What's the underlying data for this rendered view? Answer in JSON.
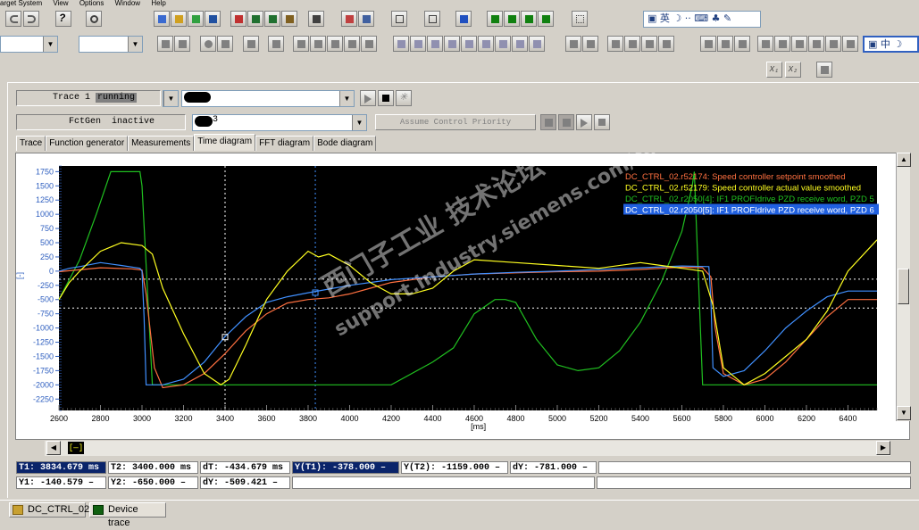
{
  "menubar": [
    "arget System",
    "View",
    "Options",
    "Window",
    "Help"
  ],
  "ime_top": {
    "label": "英",
    "extra": "☽ ·· ⌨ ♣ ✎"
  },
  "ime_right": {
    "label": "中"
  },
  "aux_buttons": [
    "X₁",
    "X₂"
  ],
  "trace": {
    "label": "Trace 1",
    "status": "running",
    "signal_combo": "",
    "fctgen_label": "FctGen",
    "fctgen_status": "inactive",
    "fctgen_combo": "3",
    "assume_button": "Assume Control Priority"
  },
  "tabs": [
    {
      "label": "Trace",
      "active": false
    },
    {
      "label": "Function generator",
      "active": false
    },
    {
      "label": "Measurements",
      "active": false
    },
    {
      "label": "Time diagram",
      "active": true
    },
    {
      "label": "FFT diagram",
      "active": false
    },
    {
      "label": "Bode diagram",
      "active": false
    }
  ],
  "watermark": {
    "line1": "西门子工业 技术论坛",
    "line2": "support.industry.siemens.com/cs"
  },
  "chart_data": {
    "type": "line",
    "xlabel": "[ms]",
    "ylabel": "[-]",
    "xlim": [
      2600,
      6540
    ],
    "ylim": [
      -2450,
      1850
    ],
    "x_ticks": [
      2600,
      2800,
      3000,
      3200,
      3400,
      3600,
      3800,
      4000,
      4200,
      4400,
      4600,
      4800,
      5000,
      5200,
      5400,
      5600,
      5800,
      6000,
      6200,
      6400
    ],
    "y_ticks": [
      1750,
      1500,
      1250,
      1000,
      750,
      500,
      250,
      0,
      -250,
      -500,
      -750,
      -1000,
      -1250,
      -1500,
      -1750,
      -2000,
      -2250
    ],
    "grid": false,
    "legend_position": "top-right",
    "cursors": {
      "t1": 3834.679,
      "t2": 3400,
      "y1": -140.579,
      "y2": -650
    },
    "series": [
      {
        "name": "DC_CTRL_02.r52174: Speed controller setpoint smoothed",
        "color": "#ff7040",
        "x": [
          2600,
          2800,
          2950,
          3000,
          3020,
          3060,
          3100,
          3200,
          3300,
          3400,
          3500,
          3600,
          3700,
          3800,
          3900,
          4000,
          4100,
          4200,
          4400,
          4600,
          4800,
          5000,
          5200,
          5400,
          5600,
          5700,
          5740,
          5760,
          5800,
          5900,
          6000,
          6100,
          6200,
          6300,
          6400,
          6540
        ],
        "y": [
          -10,
          60,
          40,
          20,
          -400,
          -1700,
          -2050,
          -2000,
          -1800,
          -1450,
          -1050,
          -750,
          -560,
          -500,
          -470,
          -400,
          -300,
          -200,
          -100,
          -50,
          -30,
          -10,
          0,
          30,
          70,
          60,
          -100,
          -1000,
          -1800,
          -2000,
          -1900,
          -1600,
          -1200,
          -800,
          -500,
          -500
        ]
      },
      {
        "name": "DC_CTRL_02.r52179: Speed controller actual value smoothed",
        "color": "#ffff20",
        "x": [
          2600,
          2650,
          2700,
          2800,
          2900,
          3000,
          3050,
          3100,
          3200,
          3300,
          3380,
          3420,
          3500,
          3600,
          3700,
          3800,
          3850,
          3900,
          4000,
          4100,
          4200,
          4300,
          4400,
          4500,
          4600,
          4800,
          5000,
          5200,
          5400,
          5500,
          5600,
          5700,
          5750,
          5800,
          5900,
          6000,
          6100,
          6200,
          6300,
          6400,
          6540
        ],
        "y": [
          -500,
          -200,
          0,
          350,
          500,
          450,
          300,
          -300,
          -1100,
          -1800,
          -2000,
          -1900,
          -1300,
          -500,
          0,
          350,
          250,
          300,
          100,
          -200,
          -400,
          -400,
          -300,
          0,
          200,
          150,
          100,
          50,
          150,
          100,
          50,
          0,
          -600,
          -1700,
          -2000,
          -1800,
          -1500,
          -1200,
          -700,
          0,
          550
        ]
      },
      {
        "name": "DC_CTRL_02.r2050[4]: IF1 PROFIdrive PZD receive word, PZD 5",
        "color": "#20c020",
        "x": [
          2600,
          2700,
          2780,
          2850,
          2990,
          3000,
          3050,
          4180,
          4200,
          4400,
          4500,
          4600,
          4700,
          4750,
          4800,
          4900,
          5000,
          5100,
          5200,
          5300,
          5400,
          5500,
          5600,
          5650,
          5660,
          5700,
          6540
        ],
        "y": [
          -500,
          200,
          1000,
          1750,
          1750,
          1500,
          -2000,
          -2000,
          -2000,
          -1600,
          -1350,
          -750,
          -500,
          -500,
          -550,
          -1200,
          -1650,
          -1750,
          -1700,
          -1400,
          -900,
          -200,
          700,
          1500,
          1750,
          -2000,
          -2000
        ]
      },
      {
        "name": "DC_CTRL_02.r2050[5]: IF1 PROFIdrive PZD receive word, PZD 6",
        "color": "#4090ff",
        "x": [
          2600,
          2650,
          2700,
          2800,
          2900,
          2990,
          3000,
          3010,
          3020,
          3100,
          3200,
          3300,
          3400,
          3500,
          3600,
          3700,
          3800,
          4000,
          4200,
          4400,
          4600,
          4800,
          5000,
          5200,
          5400,
          5600,
          5730,
          5740,
          5750,
          5800,
          5900,
          6000,
          6100,
          6200,
          6300,
          6400,
          6540
        ],
        "y": [
          0,
          50,
          80,
          150,
          100,
          50,
          0,
          -800,
          -2000,
          -2000,
          -1900,
          -1600,
          -1150,
          -800,
          -550,
          -450,
          -380,
          -250,
          -150,
          -100,
          -50,
          -20,
          0,
          30,
          60,
          90,
          80,
          -500,
          -1700,
          -1850,
          -1750,
          -1400,
          -1000,
          -700,
          -450,
          -350,
          -350
        ]
      }
    ]
  },
  "measurements": {
    "row1": [
      {
        "text": "T1:  3834.679 ms",
        "selected": true
      },
      {
        "text": "T2:  3400.000 ms",
        "selected": false
      },
      {
        "text": "dT:  -434.679 ms",
        "selected": false
      },
      {
        "text": "Y(T1):   -378.000 –",
        "selected": true
      },
      {
        "text": "Y(T2):  -1159.000 –",
        "selected": false
      },
      {
        "text": "dY:  -781.000 –",
        "selected": false
      }
    ],
    "row2": [
      {
        "text": "Y1:  -140.579 –",
        "selected": false
      },
      {
        "text": "Y2:  -650.000 –",
        "selected": false
      },
      {
        "text": "dY:  -509.421 –",
        "selected": false
      }
    ]
  },
  "statusbar": {
    "tab1": "DC_CTRL_02",
    "tab2": "Device trace"
  },
  "scroll_marker": "[—]"
}
